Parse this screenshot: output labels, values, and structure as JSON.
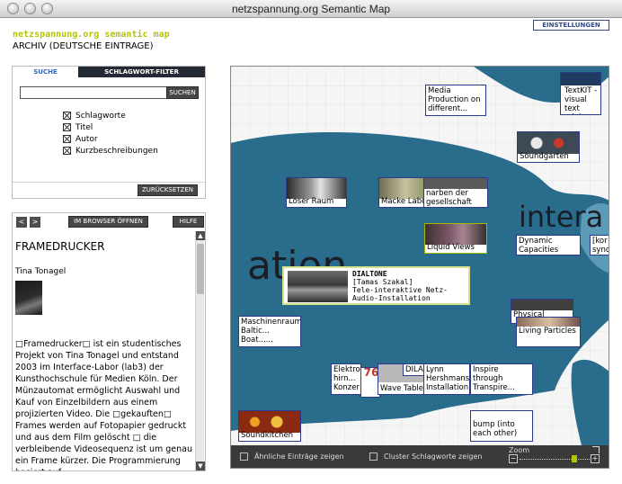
{
  "window": {
    "title": "netzspannung.org Semantic Map"
  },
  "header": {
    "settings_button": "EINSTELLUNGEN",
    "brand": "netzspannung.org semantic map",
    "subtitle": "ARCHIV (DEUTSCHE EINTRAGE)"
  },
  "search_panel": {
    "tabs": [
      "SUCHE",
      "SCHLAGWORT-FILTER"
    ],
    "input_value": "",
    "search_button": "SUCHEN",
    "checkboxes": [
      {
        "label": "Schlagworte",
        "checked": true
      },
      {
        "label": "Titel",
        "checked": true
      },
      {
        "label": "Autor",
        "checked": true
      },
      {
        "label": "Kurzbeschreibungen",
        "checked": true
      }
    ],
    "reset_button": "ZURÜCKSETZEN"
  },
  "detail_panel": {
    "prev": "<",
    "next": ">",
    "open_browser": "IM BROWSER ÖFFNEN",
    "help": "HILFE",
    "title": "FRAMEDRUCKER",
    "author": "Tina Tonagel",
    "body": "□Framedrucker□ ist ein studentisches Projekt von Tina Tonagel und entstand 2003 im Interface-Labor (lab3) der Kunsthochschule für Medien Köln. Der Münzautomat ermöglicht Auswahl und Kauf von Einzelbildern aus einem projizierten Video. Die □gekauften□ Frames werden auf Fotopapier gedruckt und aus dem Film gelöscht □ die verbleibende Videosequenz ist um genau ein Frame kürzer. Die Programmierung basiert auf"
  },
  "map": {
    "big_words": {
      "ation": "ation",
      "intera": "intera"
    },
    "nodes": [
      {
        "label": "Media Production on different..."
      },
      {
        "label": "TextKIT - visual text mining"
      },
      {
        "label": "Soundgarten"
      },
      {
        "label": "Loser Raum"
      },
      {
        "label": "Macke Labor"
      },
      {
        "label": "narben der gesellschaft"
      },
      {
        "label": "Liquid Views"
      },
      {
        "label": "Dynamic Capacities"
      },
      {
        "label": "[kor synd"
      },
      {
        "label": "Maschinenraum Baltic... Boat......"
      },
      {
        "label": "Physical"
      },
      {
        "label": "Living Particles"
      },
      {
        "label": "Elektro hirn... Konzer"
      },
      {
        "label": "Wave Table"
      },
      {
        "label": "DILA"
      },
      {
        "label": "Lynn Hershmans Installation"
      },
      {
        "label": "Inspire through Transpire..."
      },
      {
        "label": "bump (into each other)"
      },
      {
        "label": "Soundkitchen"
      }
    ],
    "tooltip": {
      "title": "DIALTONE",
      "author": "[Tamas Szakal]",
      "desc": "Tele-interaktive Netz-Audio-Installation"
    },
    "bottom_bar": {
      "similar": "Ähnliche Einträge zeigen",
      "cluster": "Cluster Schlagworte zeigen",
      "zoom_label": "Zoom",
      "zoom_level": 0.72
    }
  }
}
